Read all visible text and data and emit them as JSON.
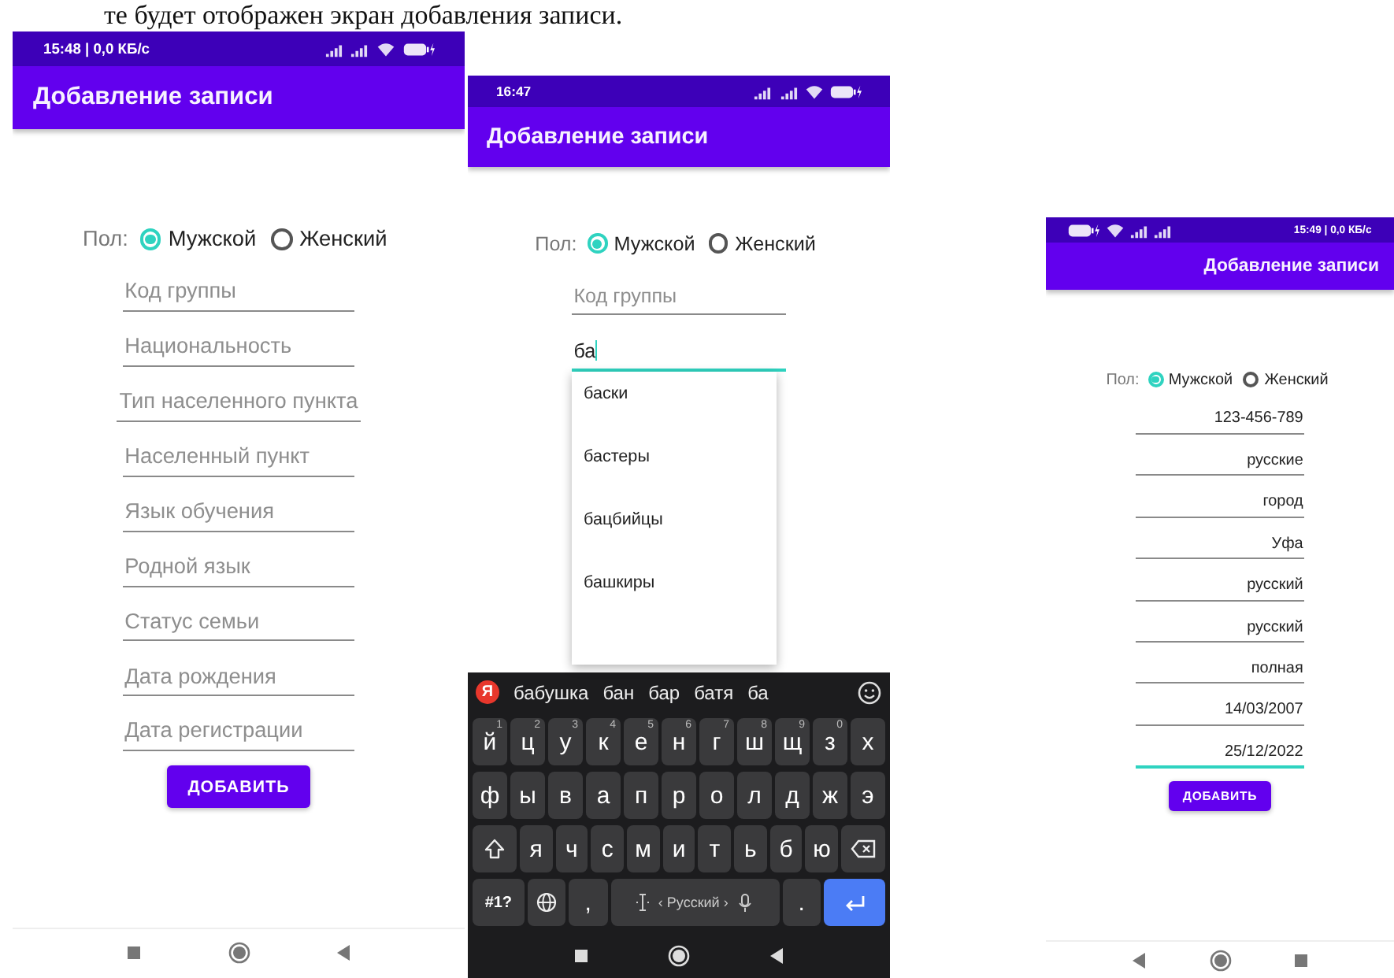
{
  "caption": "те будет отображен экран добавления записи.",
  "screens": [
    {
      "mirrored": false,
      "status_time": "15:48 | 0,0 КБ/с",
      "title": "Добавление записи",
      "gender": {
        "label": "Пол:",
        "options": [
          {
            "label": "Мужской",
            "selected": true
          },
          {
            "label": "Женский",
            "selected": false
          }
        ]
      },
      "fields": [
        {
          "placeholder": "Код группы",
          "focused": false
        },
        {
          "placeholder": "Национальность",
          "focused": false
        },
        {
          "placeholder": "Тип населенного пункта",
          "focused": false
        },
        {
          "placeholder": "Населенный пункт",
          "focused": false
        },
        {
          "placeholder": "Язык обучения",
          "focused": false
        },
        {
          "placeholder": "Родной язык",
          "focused": false
        },
        {
          "placeholder": "Статус семьи",
          "focused": false
        },
        {
          "placeholder": "Дата рождения",
          "focused": false
        },
        {
          "placeholder": "Дата регистрации",
          "focused": false
        }
      ],
      "button": "ДОБАВИТЬ"
    },
    {
      "mirrored": false,
      "status_time": "16:47",
      "title": "Добавление записи",
      "gender": {
        "label": "Пол:",
        "options": [
          {
            "label": "Мужской",
            "selected": true
          },
          {
            "label": "Женский",
            "selected": false
          }
        ]
      },
      "fields": [
        {
          "placeholder": "Код группы",
          "focused": false
        },
        {
          "value": "ба",
          "focused": true,
          "autocomplete": [
            "баски",
            "бастеры",
            "бацбийцы",
            "башкиры"
          ]
        }
      ],
      "keyboard": {
        "logo": "Я",
        "suggestions": [
          "бабушка",
          "бан",
          "бар",
          "батя",
          "ба"
        ],
        "rows": [
          {
            "keys": [
              {
                "label": "й",
                "hint": "1"
              },
              {
                "label": "ц",
                "hint": "2"
              },
              {
                "label": "у",
                "hint": "3"
              },
              {
                "label": "к",
                "hint": "4"
              },
              {
                "label": "е",
                "hint": "5"
              },
              {
                "label": "н",
                "hint": "6"
              },
              {
                "label": "г",
                "hint": "7"
              },
              {
                "label": "ш",
                "hint": "8"
              },
              {
                "label": "щ",
                "hint": "9"
              },
              {
                "label": "з",
                "hint": "0"
              },
              {
                "label": "х"
              }
            ]
          },
          {
            "keys": [
              {
                "label": "ф"
              },
              {
                "label": "ы"
              },
              {
                "label": "в"
              },
              {
                "label": "а"
              },
              {
                "label": "п"
              },
              {
                "label": "р"
              },
              {
                "label": "о"
              },
              {
                "label": "л"
              },
              {
                "label": "д"
              },
              {
                "label": "ж"
              },
              {
                "label": "э"
              }
            ]
          },
          {
            "keys": [
              {
                "kind": "shift"
              },
              {
                "label": "я"
              },
              {
                "label": "ч"
              },
              {
                "label": "с"
              },
              {
                "label": "м"
              },
              {
                "label": "и"
              },
              {
                "label": "т"
              },
              {
                "label": "ь"
              },
              {
                "label": "б"
              },
              {
                "label": "ю"
              },
              {
                "kind": "backspace"
              }
            ]
          },
          {
            "keys": [
              {
                "label": "#1?"
              },
              {
                "kind": "globe"
              },
              {
                "label": ","
              },
              {
                "kind": "space",
                "label": "‹ Русский ›"
              },
              {
                "label": "."
              },
              {
                "kind": "enter"
              }
            ]
          }
        ]
      }
    },
    {
      "mirrored": true,
      "status_time": "15:49 | 0,0 КБ/с",
      "title": "Добавление записи",
      "gender": {
        "label": "Пол:",
        "options": [
          {
            "label": "Мужской",
            "selected": true
          },
          {
            "label": "Женский",
            "selected": false
          }
        ]
      },
      "fields": [
        {
          "value": "123-456-789",
          "focused": false
        },
        {
          "value": "русские",
          "focused": false
        },
        {
          "value": "город",
          "focused": false
        },
        {
          "value": "Уфа",
          "focused": false
        },
        {
          "value": "русский",
          "focused": false
        },
        {
          "value": "русский",
          "focused": false
        },
        {
          "value": "полная",
          "focused": false
        },
        {
          "value": "14/03/2007",
          "focused": false
        },
        {
          "value": "25/12/2022",
          "focused": true
        }
      ],
      "button": "ДОБАВИТЬ"
    }
  ]
}
